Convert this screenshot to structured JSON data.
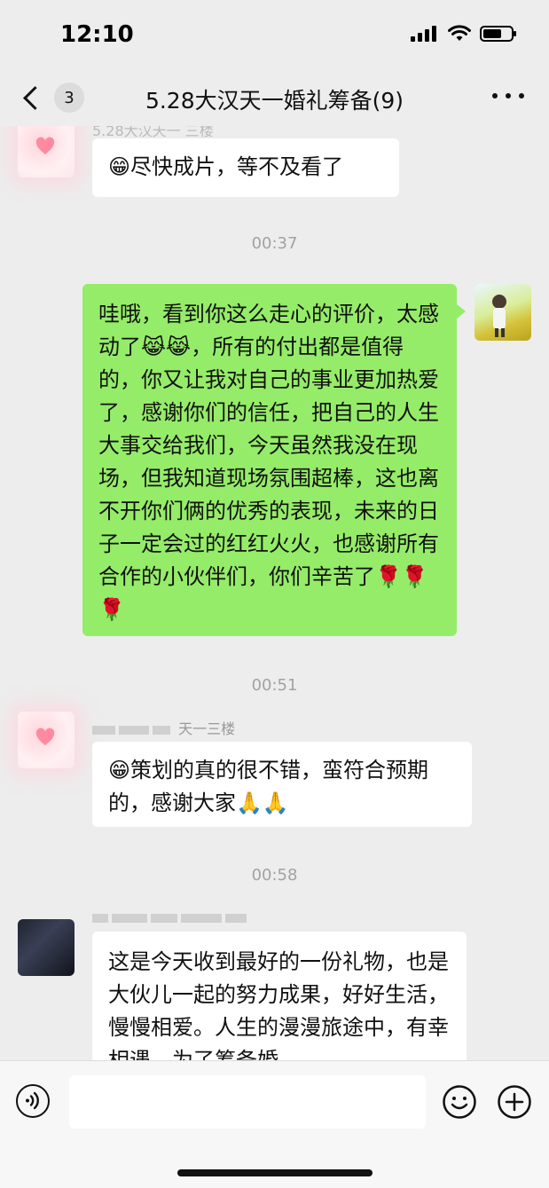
{
  "status_bar": {
    "time": "12:10"
  },
  "nav": {
    "unread_count": "3",
    "title": "5.28大汉天一婚礼筹备(9)"
  },
  "messages": [
    {
      "type": "received",
      "sender": "5.28大汉天一 三楼",
      "text": "😁尽快成片，等不及看了"
    },
    {
      "type": "time",
      "text": "00:37"
    },
    {
      "type": "sent",
      "text": "哇哦，看到你这么走心的评价，太感动了😹😹，所有的付出都是值得的，你又让我对自己的事业更加热爱了，感谢你们的信任，把自己的人生大事交给我们，今天虽然我没在现场，但我知道现场氛围超棒，这也离不开你们俩的优秀的表现，未来的日子一定会过的红红火火，也感谢所有合作的小伙伴们，你们辛苦了🌹🌹🌹"
    },
    {
      "type": "time",
      "text": "00:51"
    },
    {
      "type": "received",
      "sender": "天一三楼",
      "text": "😁策划的真的很不错，蛮符合预期的，感谢大家🙏🙏"
    },
    {
      "type": "time",
      "text": "00:58"
    },
    {
      "type": "received",
      "sender": "",
      "text": "这是今天收到最好的一份礼物，也是大伙儿一起的努力成果，好好生活，慢慢相爱。人生的漫漫旅途中，有幸相遇。为了筹备婚"
    }
  ],
  "input": {
    "placeholder": ""
  },
  "colors": {
    "background": "#ededed",
    "sent_bubble": "#95ec69",
    "received_bubble": "#ffffff",
    "timestamp": "#a2a2a2"
  },
  "icons": {
    "voice": "voice-icon",
    "emoji": "emoji-icon",
    "plus": "plus-icon",
    "back": "chevron-left-icon",
    "more": "more-icon"
  }
}
